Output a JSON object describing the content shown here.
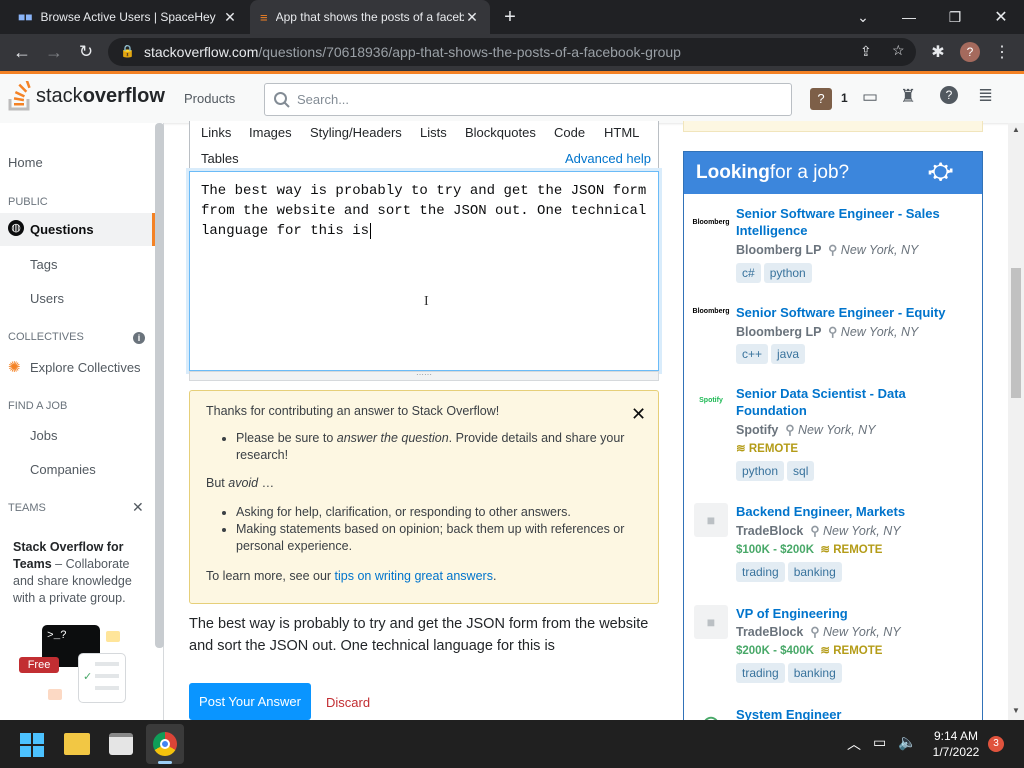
{
  "browser": {
    "tabs": [
      {
        "title": "Browse Active Users | SpaceHey",
        "active": false
      },
      {
        "title": "App that shows the posts of a facebook group",
        "active": true
      }
    ],
    "url_host": "stackoverflow.com",
    "url_path": "/questions/70618936/app-that-shows-the-posts-of-a-facebook-group"
  },
  "header": {
    "logo_text_1": "stack",
    "logo_text_2": "overflow",
    "products": "Products",
    "search_placeholder": "Search...",
    "inbox_count": "1"
  },
  "leftnav": {
    "home": "Home",
    "public": "PUBLIC",
    "questions": "Questions",
    "tags": "Tags",
    "users": "Users",
    "collectives": "COLLECTIVES",
    "explore_collectives": "Explore Collectives",
    "find_a_job": "FIND A JOB",
    "jobs": "Jobs",
    "companies": "Companies",
    "teams": "TEAMS",
    "teams_promo_bold": "Stack Overflow for Teams",
    "teams_promo_rest": " – Collaborate and share knowledge with a private group.",
    "free_badge": "Free"
  },
  "editor": {
    "toolbar": [
      "Links",
      "Images",
      "Styling/Headers",
      "Lists",
      "Blockquotes",
      "Code",
      "HTML"
    ],
    "tables": "Tables",
    "advanced_help": "Advanced help",
    "content": "The best way is probably to try and get the JSON form from the website and sort the JSON out. One technical language for this is "
  },
  "guide": {
    "intro": "Thanks for contributing an answer to Stack Overflow!",
    "bullet1_pre": "Please be sure to ",
    "bullet1_em": "answer the question",
    "bullet1_post": ". Provide details and share your research!",
    "but_pre": "But ",
    "but_em": "avoid",
    "but_post": " …",
    "avoid1": "Asking for help, clarification, or responding to other answers.",
    "avoid2": "Making statements based on opinion; back them up with references or personal experience.",
    "learn_pre": "To learn more, see our ",
    "learn_link": "tips on writing great answers",
    "learn_post": "."
  },
  "preview": "The best way is probably to try and get the JSON form from the website and sort the JSON out. One technical language for this is",
  "actions": {
    "post": "Post Your Answer",
    "discard": "Discard"
  },
  "jobs": {
    "heading_bold": "Looking",
    "heading_rest": " for a job?",
    "items": [
      {
        "title": "Senior Software Engineer - Sales Intelligence",
        "company": "Bloomberg LP",
        "location": "New York, NY",
        "logo": "Bloomberg",
        "salary": "",
        "remote": "",
        "tags": [
          "c#",
          "python"
        ]
      },
      {
        "title": "Senior Software Engineer - Equity",
        "company": "Bloomberg LP",
        "location": "New York, NY",
        "logo": "Bloomberg",
        "salary": "",
        "remote": "",
        "tags": [
          "c++",
          "java"
        ]
      },
      {
        "title": "Senior Data Scientist - Data Foundation",
        "company": "Spotify",
        "location": "New York, NY",
        "logo": "Spotify",
        "salary": "",
        "remote": "REMOTE",
        "tags": [
          "python",
          "sql"
        ]
      },
      {
        "title": "Backend Engineer, Markets",
        "company": "TradeBlock",
        "location": "New York, NY",
        "logo": "",
        "salary": "$100K - $200K",
        "remote": "REMOTE",
        "tags": [
          "trading",
          "banking"
        ]
      },
      {
        "title": "VP of Engineering",
        "company": "TradeBlock",
        "location": "New York, NY",
        "logo": "",
        "salary": "$200K - $400K",
        "remote": "REMOTE",
        "tags": [
          "trading",
          "banking"
        ]
      },
      {
        "title": "System Engineer",
        "company": "",
        "location": "",
        "logo": "",
        "salary": "",
        "remote": "",
        "tags": []
      }
    ]
  },
  "taskbar": {
    "time": "9:14 AM",
    "date": "1/7/2022",
    "notifications": "3"
  },
  "colors": {
    "so_orange": "#f48225",
    "link_blue": "#0074cc",
    "post_button": "#0a95ff",
    "guide_bg": "#fdf7e2",
    "jobs_header": "#3c86dc"
  }
}
